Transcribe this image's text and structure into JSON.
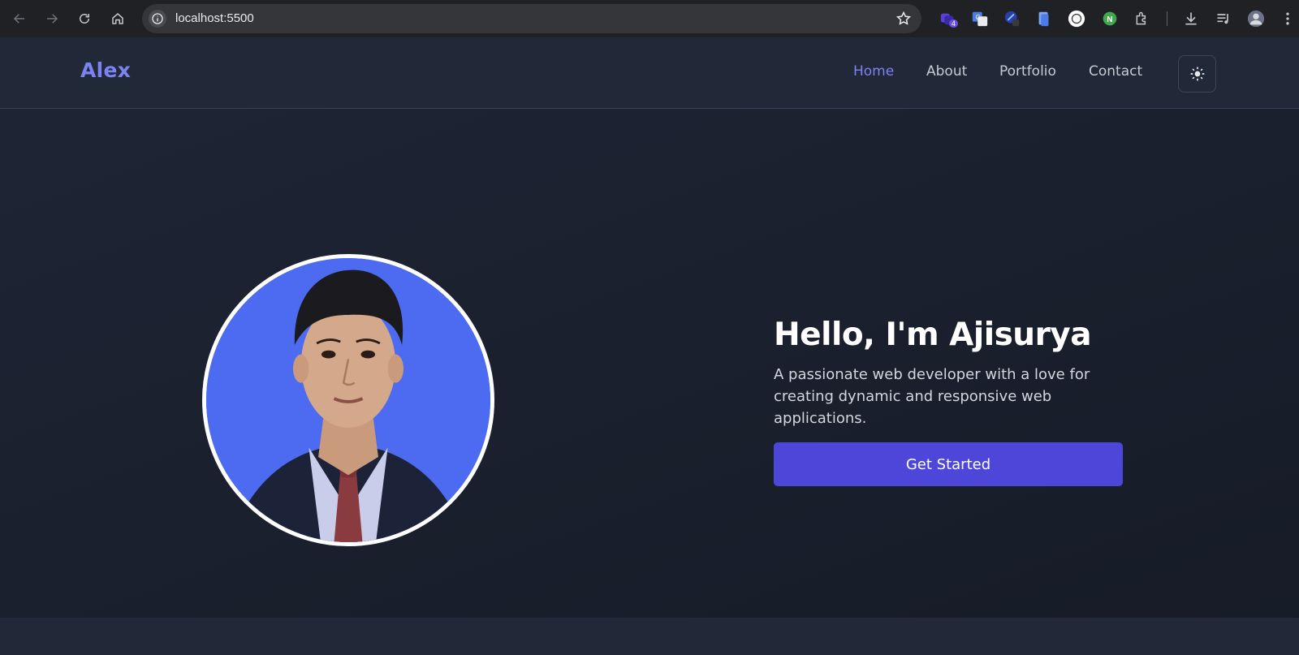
{
  "browser": {
    "url": "localhost:5500",
    "extension_badge": "4",
    "extensions": [
      "stack-extension-icon",
      "translate-extension-icon",
      "pen-extension-icon",
      "docs-extension-icon",
      "circle-extension-icon",
      "node-extension-icon",
      "puzzle-extension-icon"
    ]
  },
  "site": {
    "logo": "Alex",
    "nav": {
      "home": "Home",
      "about": "About",
      "portfolio": "Portfolio",
      "contact": "Contact"
    },
    "theme_icon": "sun-icon",
    "accent_color": "#7c82f2"
  },
  "hero": {
    "title": "Hello, I'm Ajisurya",
    "subtitle": "A passionate web developer with a love for creating dynamic and responsive web applications.",
    "cta_label": "Get Started",
    "cta_color": "#4d46d9"
  }
}
